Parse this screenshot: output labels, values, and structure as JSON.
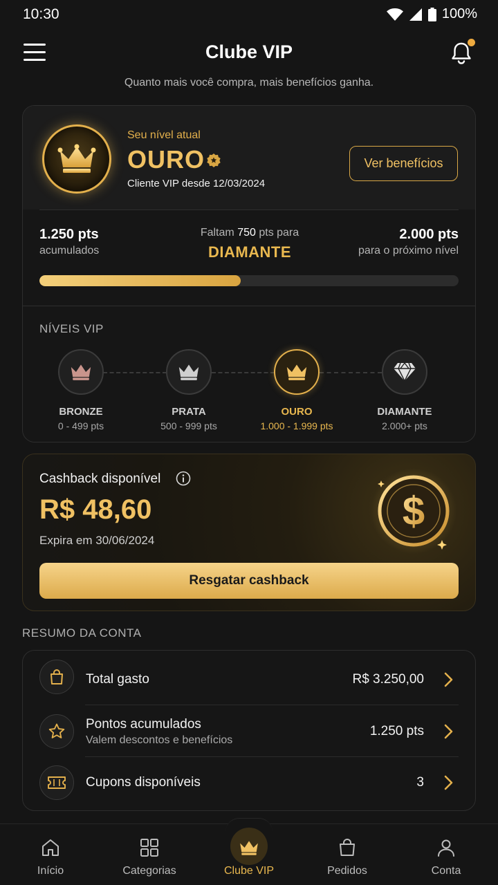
{
  "status_bar": {
    "time": "10:30",
    "battery": "100%"
  },
  "header": {
    "title": "Clube VIP",
    "subtitle": "Quanto mais você compra, mais benefícios ganha."
  },
  "vip_card": {
    "level_caption": "Seu nível atual",
    "level_name": "OURO",
    "since": "Cliente VIP desde 12/03/2024",
    "benefits_button": "Ver benefícios",
    "points": {
      "current_value": "1.250 pts",
      "current_label": "acumulados",
      "remaining_prefix": "Faltam",
      "remaining_value": "750",
      "remaining_suffix": "pts para",
      "next_level": "DIAMANTE",
      "target_value": "2.000 pts",
      "target_label": "para o próximo nível",
      "progress_percent": 48
    },
    "levels_title": "NÍVEIS VIP",
    "levels": [
      {
        "name": "BRONZE",
        "range": "0 - 499 pts",
        "icon": "crown-icon",
        "color": "#c9948c"
      },
      {
        "name": "PRATA",
        "range": "500 - 999 pts",
        "icon": "crown-icon",
        "color": "#c8c8c8"
      },
      {
        "name": "OURO",
        "range": "1.000 - 1.999 pts",
        "icon": "crown-icon",
        "color": "#e9b84f"
      },
      {
        "name": "DIAMANTE",
        "range": "2.000+ pts",
        "icon": "diamond-icon",
        "color": "#d8d8d8"
      }
    ]
  },
  "cashback": {
    "label": "Cashback disponível",
    "value": "R$ 48,60",
    "expires": "Expira em 30/06/2024",
    "button": "Resgatar cashback"
  },
  "resume": {
    "title": "RESUMO DA CONTA",
    "rows": [
      {
        "title": "Total gasto",
        "subtitle": "",
        "value": "R$ 3.250,00",
        "icon": "shopping-bag-icon"
      },
      {
        "title": "Pontos acumulados",
        "subtitle": "Valem descontos e benefícios",
        "value": "1.250 pts",
        "icon": "star-icon"
      },
      {
        "title": "Cupons disponíveis",
        "subtitle": "",
        "value": "3",
        "icon": "ticket-icon"
      }
    ]
  },
  "nav": [
    {
      "label": "Início",
      "icon": "home-icon"
    },
    {
      "label": "Categorias",
      "icon": "grid-icon"
    },
    {
      "label": "Clube VIP",
      "icon": "crown-icon",
      "active": true
    },
    {
      "label": "Pedidos",
      "icon": "bag-icon"
    },
    {
      "label": "Conta",
      "icon": "user-icon"
    }
  ],
  "colors": {
    "accent": "#e9b84f",
    "background": "#151515"
  }
}
